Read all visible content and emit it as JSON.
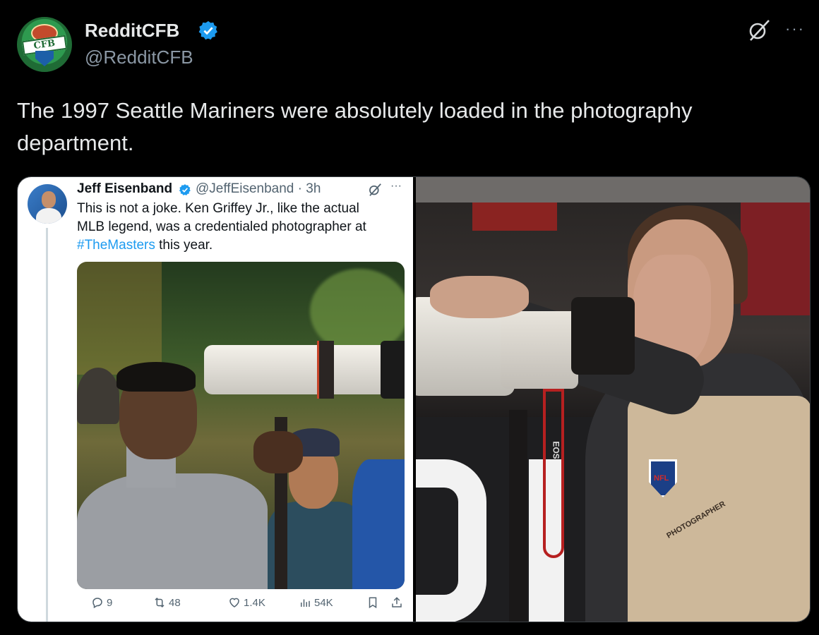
{
  "post": {
    "author_name": "RedditCFB",
    "handle": "@RedditCFB",
    "avatar_text": "CFB",
    "text": "The 1997 Seattle Mariners were absolutely loaded in the photography department.",
    "verified_color": "#1d9bf0"
  },
  "quoted": {
    "author_name": "Jeff Eisenband",
    "meta": "@JeffEisenband · 3h",
    "body_lines": [
      "This is not a joke. Ken Griffey Jr., like the actual",
      "MLB legend, was a credentialed photographer at"
    ],
    "hashtag": "#TheMasters",
    "body_tail": " this year.",
    "more": "···",
    "actions": {
      "replies": "9",
      "reposts": "48",
      "likes": "1.4K",
      "views": "54K"
    },
    "link_color": "#1d9bf0"
  },
  "right_photo": {
    "vest_logo": "NFL",
    "vest_text": "PHOTOGRAPHER",
    "strap_text": "EOS"
  },
  "icons": {
    "verified": "verified-badge-icon",
    "grok": "grok-icon",
    "more": "more-icon",
    "reply": "reply-icon",
    "repost": "repost-icon",
    "like": "like-icon",
    "views": "views-icon",
    "bookmark": "bookmark-icon",
    "share": "share-icon"
  }
}
